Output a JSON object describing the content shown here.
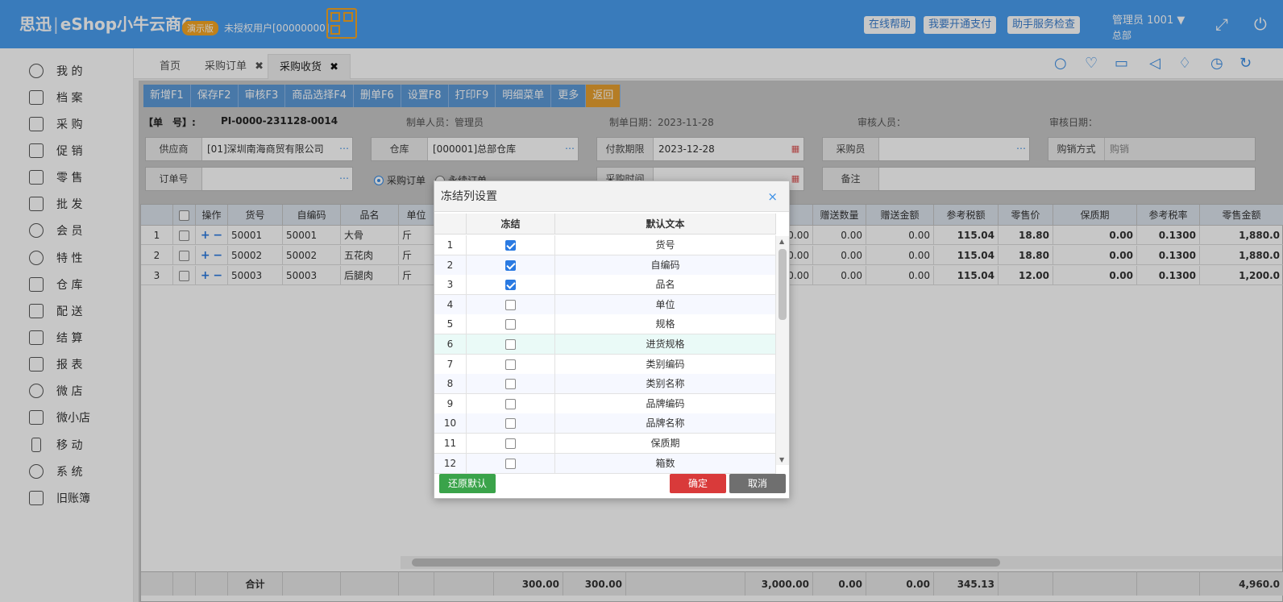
{
  "topbar": {
    "logo_brand": "思迅",
    "logo_product": "eShop小牛云商6",
    "demo_badge": "演示版",
    "unauth_user": "未授权用户[00000000]",
    "buttons": [
      "在线帮助",
      "我要开通支付",
      "助手服务检查"
    ],
    "admin": "管理员 1001",
    "branch": "总部",
    "colors": {
      "bar": "#4a9ef0",
      "badge": "#f5a623"
    }
  },
  "sidebar": {
    "items": [
      "我 的",
      "档 案",
      "采 购",
      "促 销",
      "零 售",
      "批 发",
      "会 员",
      "特 性",
      "仓 库",
      "配 送",
      "结 算",
      "报 表",
      "微 店",
      "微小店",
      "移 动",
      "系 统",
      "旧账簿"
    ]
  },
  "tabs": [
    {
      "label": "首页"
    },
    {
      "label": "采购订单"
    },
    {
      "label": "采购收货"
    }
  ],
  "toolbar": {
    "buttons": [
      "新增F1",
      "保存F2",
      "审核F3",
      "商品选择F4",
      "删单F6",
      "设置F8",
      "打印F9",
      "明细菜单",
      "更多",
      "返回"
    ]
  },
  "header": {
    "order_no_label": "【单　号】:",
    "order_no": "PI-0000-231128-0014",
    "creator": "制单人员：管理员",
    "create_date": "制单日期：2023-11-28",
    "auditor": "审核人员：",
    "audit_date": "审核日期："
  },
  "form": {
    "supplier_label": "供应商",
    "supplier": "[01]深圳南海商贸有限公司",
    "warehouse_label": "仓库",
    "warehouse": "[000001]总部仓库",
    "pay_label": "付款期限",
    "pay_date": "2023-12-28",
    "buyer_label": "采购员",
    "buyer": "",
    "method_label": "购销方式",
    "method": "购销",
    "order_label": "订单号",
    "order": "",
    "radio_a": "采购订单",
    "radio_b": "永续订单",
    "purchase_time_label": "采购时间",
    "note_label": "备注",
    "note": ""
  },
  "grid": {
    "headers": [
      "",
      "",
      "操作",
      "货号",
      "自编码",
      "品名",
      "单位",
      "",
      "",
      "",
      "",
      "",
      "赠送数量",
      "赠送金额",
      "参考税额",
      "零售价",
      "保质期",
      "参考税率",
      "零售金额"
    ],
    "rows": [
      {
        "n": "1",
        "code": "50001",
        "self": "50001",
        "name": "大骨",
        "unit": "斤",
        "qty": "0.00",
        "gift_qty": "0.00",
        "gift_amt": "0.00",
        "tax": "115.04",
        "price": "18.80",
        "shelf": "0.00",
        "rate": "0.1300",
        "amount": "1,880.0"
      },
      {
        "n": "2",
        "code": "50002",
        "self": "50002",
        "name": "五花肉",
        "unit": "斤",
        "qty": "0.00",
        "gift_qty": "0.00",
        "gift_amt": "0.00",
        "tax": "115.04",
        "price": "18.80",
        "shelf": "0.00",
        "rate": "0.1300",
        "amount": "1,880.0"
      },
      {
        "n": "3",
        "code": "50003",
        "self": "50003",
        "name": "后腿肉",
        "unit": "斤",
        "qty": "0.00",
        "gift_qty": "0.00",
        "gift_amt": "0.00",
        "tax": "115.04",
        "price": "12.00",
        "shelf": "0.00",
        "rate": "0.1300",
        "amount": "1,200.0"
      }
    ],
    "footer": {
      "label": "合计",
      "v1": "300.00",
      "v2": "300.00",
      "v3": "3,000.00",
      "v4": "0.00",
      "v5": "0.00",
      "v6": "345.13",
      "v7": "4,960.0"
    }
  },
  "dialog": {
    "title": "冻结列设置",
    "close": "×",
    "col_freeze": "冻结",
    "col_text": "默认文本",
    "rows": [
      {
        "n": "1",
        "checked": true,
        "text": "货号"
      },
      {
        "n": "2",
        "checked": true,
        "text": "自编码"
      },
      {
        "n": "3",
        "checked": true,
        "text": "品名"
      },
      {
        "n": "4",
        "checked": false,
        "text": "单位"
      },
      {
        "n": "5",
        "checked": false,
        "text": "规格"
      },
      {
        "n": "6",
        "checked": false,
        "text": "进货规格"
      },
      {
        "n": "7",
        "checked": false,
        "text": "类别编码"
      },
      {
        "n": "8",
        "checked": false,
        "text": "类别名称"
      },
      {
        "n": "9",
        "checked": false,
        "text": "品牌编码"
      },
      {
        "n": "10",
        "checked": false,
        "text": "品牌名称"
      },
      {
        "n": "11",
        "checked": false,
        "text": "保质期"
      },
      {
        "n": "12",
        "checked": false,
        "text": "箱数"
      }
    ],
    "restore": "还原默认",
    "ok": "确定",
    "cancel": "取消",
    "colors": {
      "restore": "#3aa34a",
      "ok": "#d93a3a",
      "cancel": "#6f6f6f"
    }
  }
}
